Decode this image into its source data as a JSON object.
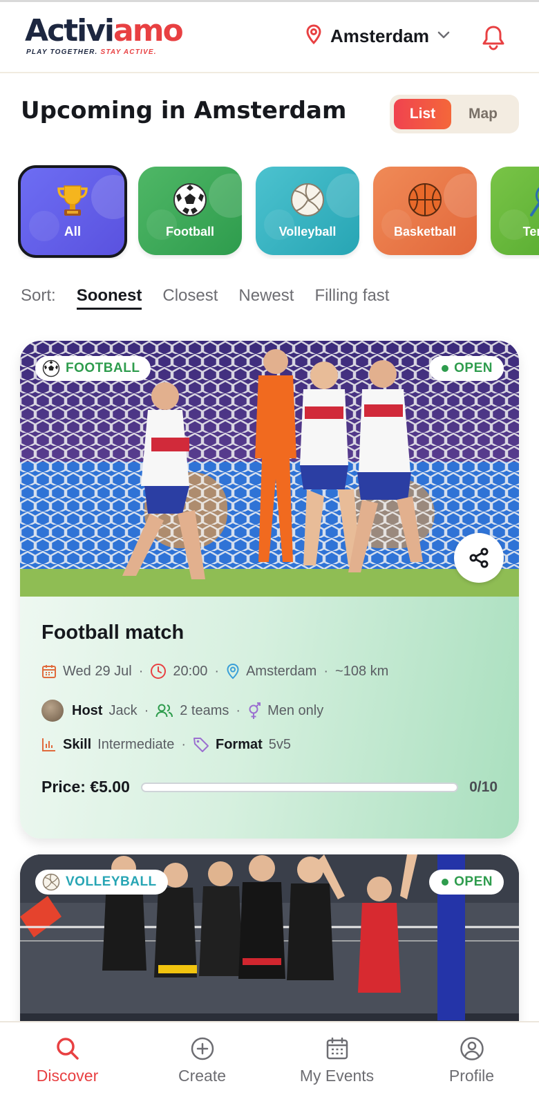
{
  "header": {
    "logo_part1": "Activi",
    "logo_part2": "amo",
    "tagline_part1": "PLAY TOGETHER.",
    "tagline_part2": "STAY ACTIVE.",
    "location": "Amsterdam",
    "icons": [
      "location-pin-icon",
      "chevron-down-icon",
      "bell-icon"
    ]
  },
  "title": "Upcoming in Amsterdam",
  "view_toggle": {
    "list": "List",
    "map": "Map",
    "selected": "List"
  },
  "categories": [
    {
      "label": "All",
      "icon": "trophy-icon",
      "selected": true
    },
    {
      "label": "Football",
      "icon": "soccer-ball-icon"
    },
    {
      "label": "Volleyball",
      "icon": "volleyball-icon"
    },
    {
      "label": "Basketball",
      "icon": "basketball-icon"
    },
    {
      "label": "Tennis",
      "icon": "tennis-icon"
    }
  ],
  "sort": {
    "label": "Sort:",
    "options": [
      "Soonest",
      "Closest",
      "Newest",
      "Filling fast"
    ],
    "selected": "Soonest"
  },
  "events": [
    {
      "sport": "FOOTBALL",
      "status": "OPEN",
      "title": "Football match",
      "date": "Wed 29 Jul",
      "time": "20:00",
      "location": "Amsterdam",
      "distance": "~108 km",
      "host_label": "Host",
      "host_name": "Jack",
      "teams": "2 teams",
      "gender": "Men only",
      "skill_label": "Skill",
      "skill_value": "Intermediate",
      "format_label": "Format",
      "format_value": "5v5",
      "price": "Price: €5.00",
      "filled": 0,
      "capacity": 10,
      "count": "0/10"
    },
    {
      "sport": "VOLLEYBALL",
      "status": "OPEN"
    }
  ],
  "bottom_nav": [
    {
      "label": "Discover",
      "icon": "search-icon",
      "active": true
    },
    {
      "label": "Create",
      "icon": "plus-circle-icon"
    },
    {
      "label": "My Events",
      "icon": "calendar-icon"
    },
    {
      "label": "Profile",
      "icon": "user-circle-icon"
    }
  ],
  "colors": {
    "brand_red": "#e84042",
    "brand_navy": "#1d2740",
    "open_green": "#2e9c4d",
    "volleyball_teal": "#27a5b4"
  }
}
